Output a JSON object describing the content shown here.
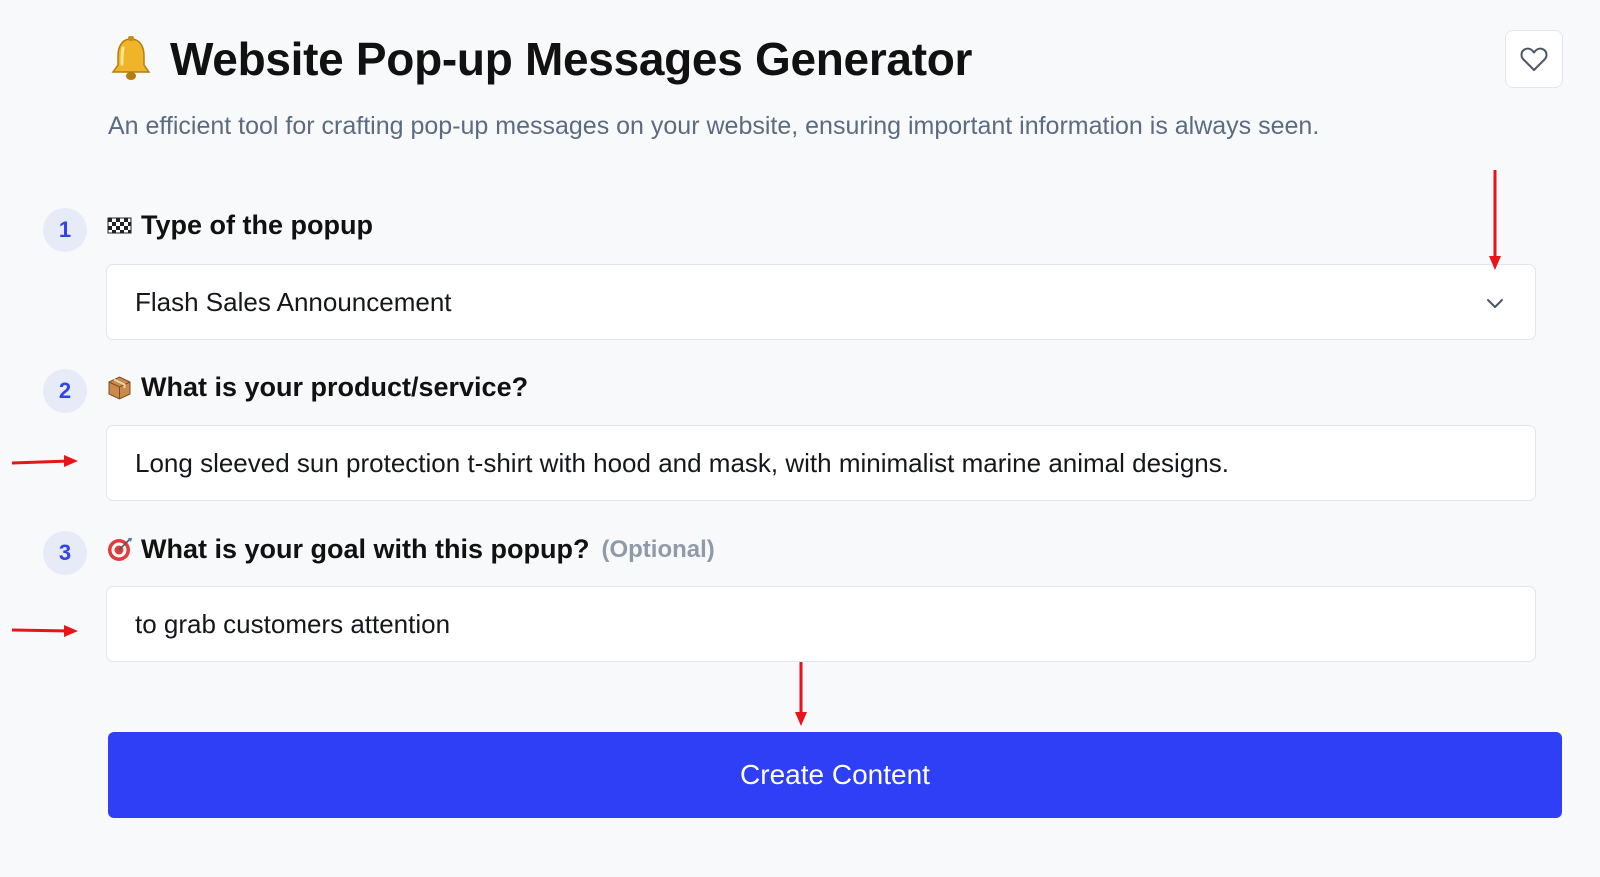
{
  "header": {
    "title": "Website Pop-up Messages Generator",
    "subtitle": "An efficient tool for crafting pop-up messages on your website, ensuring important information is always seen.",
    "icon": "bell-icon",
    "favorite_icon": "heart-icon"
  },
  "form": {
    "fields": [
      {
        "step": "1",
        "icon": "checkered-flag-icon",
        "label": "Type of the popup",
        "value": "Flash Sales Announcement",
        "type": "select"
      },
      {
        "step": "2",
        "icon": "package-icon",
        "label": "What is your product/service?",
        "value": "Long sleeved sun protection t-shirt with hood and mask, with minimalist marine animal designs.",
        "type": "text"
      },
      {
        "step": "3",
        "icon": "target-icon",
        "label": "What is your goal with this popup?",
        "optional": "(Optional)",
        "value": "to grab customers attention",
        "type": "text"
      }
    ],
    "submit_label": "Create Content"
  },
  "colors": {
    "accent": "#2f3ff5",
    "step_badge_bg": "#e7ebf8",
    "step_badge_text": "#2f45e8",
    "annotation_arrow": "#e8141a"
  }
}
